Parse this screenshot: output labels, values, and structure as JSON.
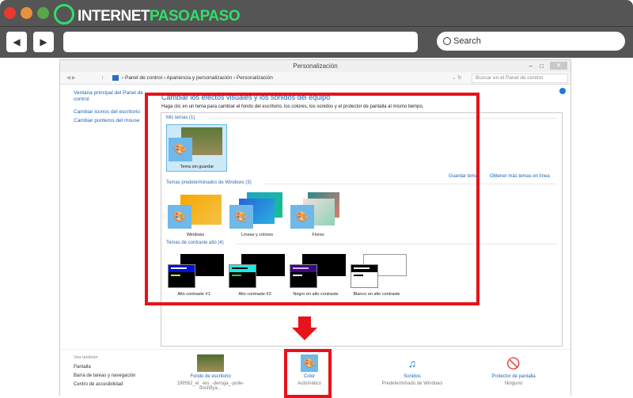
{
  "browser": {
    "logo_part1": "INTERNET",
    "logo_part2": "PASOAPASO",
    "search_placeholder": "Search",
    "back": "◀",
    "forward": "▶"
  },
  "window": {
    "title": "Personalización",
    "breadcrumb": [
      "Panel de control",
      "Apariencia y personalización",
      "Personalización"
    ],
    "search_placeholder": "Buscar en el Panel de control"
  },
  "sidebar": {
    "items": [
      "Ventana principal del Panel de control",
      "Cambiar iconos del escritorio",
      "Cambiar punteros del mouse"
    ],
    "see_also_title": "Vea también",
    "see_also": [
      "Pantalla",
      "Barra de tareas y navegación",
      "Centro de accesibilidad"
    ]
  },
  "main": {
    "heading": "Cambiar los efectos visuales y los sonidos del equipo",
    "description": "Haga clic en un tema para cambiar el fondo del escritorio, los colores, los sonidos y el protector de pantalla al mismo tiempo.",
    "my_themes": {
      "title": "Mis temas (1)",
      "items": [
        "Tema sin guardar"
      ]
    },
    "save_theme": "Guardar tema",
    "get_more": "Obtener más temas en línea",
    "default_themes": {
      "title": "Temas predeterminados de Windows (3)",
      "items": [
        "Windows",
        "Líneas y colores",
        "Flores"
      ]
    },
    "contrast_themes": {
      "title": "Temas de contraste alto (4)",
      "items": [
        "Alto contraste #1",
        "Alto contraste #2",
        "Negro en alto contraste",
        "Blanco en alto contraste"
      ]
    }
  },
  "bottom": [
    {
      "label": "Fondo de escritorio",
      "value": "199562_el_-les_-deroga_-poile-dochdya..."
    },
    {
      "label": "Color",
      "value": "Automático"
    },
    {
      "label": "Sonidos",
      "value": "Predeterminado de Windows"
    },
    {
      "label": "Protector de pantalla",
      "value": "Ninguno"
    }
  ],
  "colors": {
    "highlight": "#e8121a",
    "link": "#1e63b8",
    "logo_green": "#2ee06a"
  }
}
